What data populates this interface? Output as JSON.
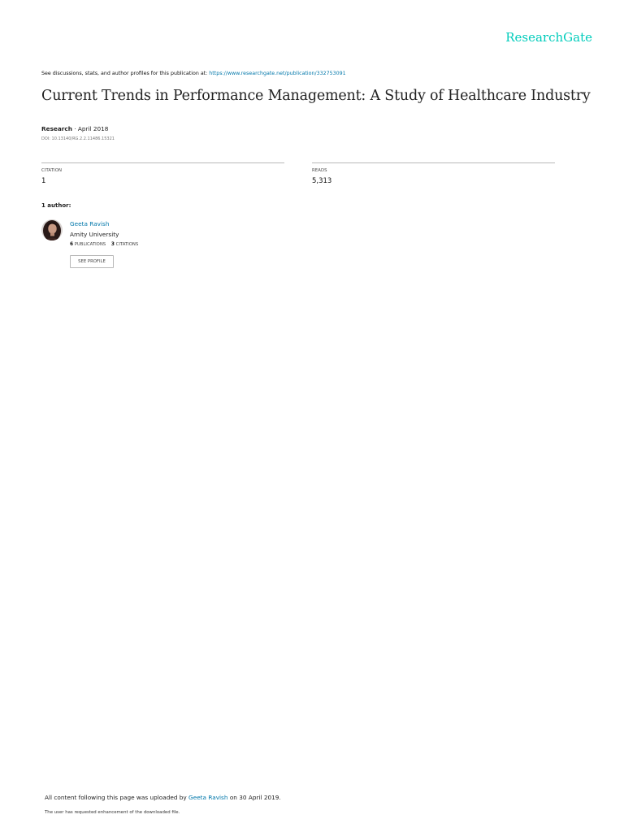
{
  "header": {
    "logo_text": "ResearchGate",
    "logo_color": "#00ccbb"
  },
  "discussion": {
    "prefix": "See discussions, stats, and author profiles for this publication at: ",
    "url": "https://www.researchgate.net/publication/332753091"
  },
  "publication": {
    "title": "Current Trends in Performance Management: A Study of Healthcare Industry",
    "type": "Research",
    "date_sep": " · ",
    "date": "April 2018",
    "doi": "DOI: 10.13140/RG.2.2.11486.15321"
  },
  "stats": {
    "citation_label": "CITATION",
    "citation_value": "1",
    "reads_label": "READS",
    "reads_value": "5,313"
  },
  "authors": {
    "label": "1 author:",
    "items": [
      {
        "name": "Geeta Ravish",
        "institution": "Amity University",
        "publications_count": "6",
        "publications_label": "PUBLICATIONS",
        "citations_count": "3",
        "citations_label": "CITATIONS",
        "see_profile_label": "SEE PROFILE"
      }
    ]
  },
  "footer": {
    "upload_prefix": "All content following this page was uploaded by ",
    "uploader": "Geeta Ravish",
    "upload_suffix": " on 30 April 2019.",
    "note": "The user has requested enhancement of the downloaded file."
  },
  "colors": {
    "link": "#0077aa",
    "rule": "#b8b8b8"
  }
}
